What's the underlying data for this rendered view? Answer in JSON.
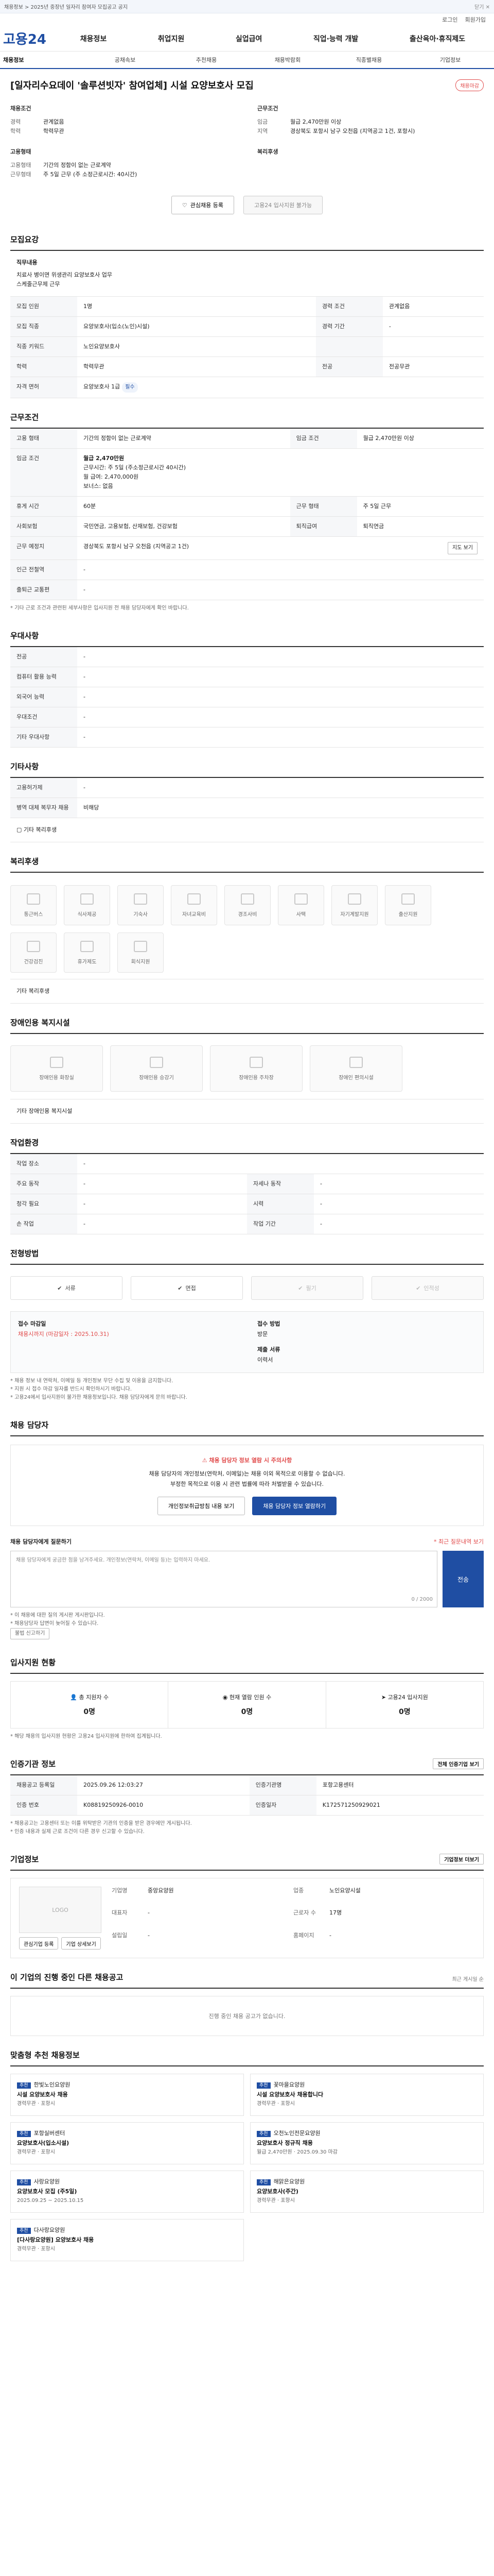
{
  "topbar": {
    "text": "채용정보 > 2025년 중장년 일자리 참여자 모집공고 공지",
    "close": "닫기 ✕"
  },
  "util": {
    "links": [
      "로그인",
      "회원가입"
    ]
  },
  "gnb": {
    "logo": "고용24",
    "menu": [
      "채용정보",
      "취업지원",
      "실업급여",
      "직업·능력 개발",
      "출산육아·휴직제도"
    ]
  },
  "subnav": [
    "채용정보",
    "공채속보",
    "추천채용",
    "채용박람회",
    "직종별채용",
    "기업정보"
  ],
  "hero": {
    "title": "[일자리수요데이 '솔루션빗자' 참여업체] 시설 요양보호사 모집",
    "badge": "채용마감",
    "left_heading": "채용조건",
    "left": [
      {
        "k": "경력",
        "v": "관계없음"
      },
      {
        "k": "학력",
        "v": "학력무관"
      }
    ],
    "left2_heading": "고용형태",
    "left2": [
      {
        "k": "고용형태",
        "v": "기간의 정함이 없는 근로계약"
      },
      {
        "k": "근무형태",
        "v": "주 5일 근무 (주 소정근로시간: 40시간)"
      }
    ],
    "right_heading": "근무조건",
    "right": [
      {
        "k": "임금",
        "v": "월급 2,470만원 이상"
      },
      {
        "k": "지역",
        "v": "경상북도 포항시 남구 오천읍 (지역공고 1건, 포항시)"
      }
    ],
    "right2_heading": "복리후생",
    "scrap_btn": "관심채용 등록",
    "apply_btn": "고용24 입사지원 불가능"
  },
  "recruit_title": "모집요강",
  "duties": {
    "label": "직무내용",
    "lines": [
      "치료사 병이면 위생관리 요양보호사 업무",
      "스케줄근무제 근무"
    ]
  },
  "recruit_rows": [
    {
      "k": "모집 인원",
      "v": "1명",
      "k2": "경력 조건",
      "v2": "관계없음"
    },
    {
      "k": "모집 직종",
      "v": "요양보호사(입소(노인)시설)",
      "k2": "경력 기간",
      "v2": "-"
    },
    {
      "k": "직종 키워드",
      "v": "노인요양보호사",
      "k2": "",
      "v2": ""
    },
    {
      "k": "학력",
      "v": "학력무관",
      "k2": "전공",
      "v2": "전공무관"
    },
    {
      "k": "자격 면허",
      "v": "요양보호사 1급",
      "k2": "",
      "v2": ""
    }
  ],
  "work_title": "근무조건",
  "work": {
    "type": "기간의 정함이 없는 근로계약",
    "probation_k": "임금 조건",
    "probation": "월급 2,470만원 이상",
    "wage_detail": [
      "월급 2,470만원",
      "근무시간: 주 5일 (주소정근로시간 40시간)",
      "월 급여: 2,470,000원",
      "보너스: 없음"
    ],
    "rest_k": "휴게 시간",
    "rest": "60분",
    "days_k": "근무 형태",
    "days": "주 5일 근무",
    "insurance_k": "사회보험",
    "insurance": "국민연금, 고용보험, 산재보험, 건강보험",
    "retire_k": "퇴직급여",
    "retire": "퇴직연금",
    "place_k": "근무 예정지",
    "place": "경상북도 포항시 남구 오천읍 (지역공고 1건)",
    "place_btn": "지도 보기",
    "commute_k": "인근 전철역",
    "commute": "-",
    "vehicle_k": "출퇴근 교통편",
    "vehicle": "-",
    "note": "* 기타 근로 조건과 관련된 세부사항은 입사지원 전 채용 담당자에게 확인 바랍니다."
  },
  "special_title": "우대사항",
  "special_rows": [
    {
      "k": "전공",
      "v": "-"
    },
    {
      "k": "컴퓨터 활용 능력",
      "v": "-"
    },
    {
      "k": "외국어 능력",
      "v": "-"
    },
    {
      "k": "우대조건",
      "v": "-"
    },
    {
      "k": "기타 우대사항",
      "v": "-"
    }
  ],
  "etc_title": "기타사항",
  "etc_rows": [
    {
      "k": "고용허가제",
      "v": "-"
    },
    {
      "k": "병역 대체 복무자 채용",
      "v": "비해당"
    }
  ],
  "etc_more": "기타 복리후생",
  "welfare_title": "복리후생",
  "welfare_icons": [
    "통근버스",
    "식사제공",
    "기숙사",
    "자녀교육비",
    "경조사비",
    "사택",
    "자기계발지원",
    "출산지원",
    "건강검진",
    "휴가제도",
    "회식지원"
  ],
  "welfare_etc": "기타 복리후생",
  "disabled_title": "장애인용 복지시설",
  "disabled_icons": [
    "장애인용 화장실",
    "장애인용 승강기",
    "장애인용 주차장",
    "장애인 편의시설"
  ],
  "disabled_etc": "기타 장애인용 복지시설",
  "conditions_title": "작업환경",
  "conditions_rows": [
    {
      "k": "작업 장소",
      "v": "-",
      "k2": "",
      "v2": ""
    },
    {
      "k": "주요 동작",
      "v": "-",
      "k2": "자세나 동작",
      "v2": "-"
    },
    {
      "k": "청각 필요",
      "v": "-",
      "k2": "시력",
      "v2": "-"
    },
    {
      "k": "손 작업",
      "v": "-",
      "k2": "작업 기간",
      "v2": "-"
    }
  ],
  "method_title": "전형방법",
  "methods": [
    "서류",
    "면접",
    "필기",
    "인적성"
  ],
  "apply": {
    "col1_label": "접수 마감일",
    "col1_value": "채용시까지 (마감일자 : 2025.10.31)",
    "col2_label": "접수 방법",
    "col2_value": "방문",
    "col3_label": "제출 서류",
    "col3_value": "이력서"
  },
  "apply_notes": [
    "* 채용 정보 내 연락처, 이메일 등 개인정보 무단 수집 및 이용을 금지합니다.",
    "* 지원 시 접수 마감 일자를 반드시 확인하시기 바랍니다.",
    "* 고용24에서 입사지원이 불가한 채용정보입니다. 채용 담당자에게 문의 바랍니다."
  ],
  "contact_title": "채용 담당자",
  "contact": {
    "alert_title": "⚠ 채용 담당자 정보 열람 시 주의사항",
    "alert_lines": [
      "채용 담당자의 개인정보(연락처, 이메일)는 채용 이외 목적으로 이용할 수 없습니다.",
      "부정한 목적으로 이용 시 관련 법률에 따라 처벌받을 수 있습니다."
    ],
    "btn1": "개인정보취급방침 내용 보기",
    "btn2": "채용 담당자 정보 열람하기"
  },
  "qa": {
    "label": "채용 담당자에게 질문하기",
    "hint": "* 최근 질문내역 보기",
    "placeholder": "채용 담당자에게 궁금한 점을 남겨주세요. 개인정보(연락처, 이메일 등)는 입력하지 마세요.",
    "count": "0 / 2000",
    "send": "전송",
    "notes": [
      "* 이 채용에 대한 질의 게시판 게시판입니다.",
      "* 채용담당자 답변이 늦어질 수 있습니다."
    ],
    "report_btn": "불법 신고하기"
  },
  "stats_title": "입사지원 현황",
  "stats": [
    {
      "label": "총 지원자 수",
      "value": "0명"
    },
    {
      "label": "현재 열람 인원 수",
      "value": "0명"
    },
    {
      "label": "고용24 입사지원",
      "value": "0명"
    }
  ],
  "stats_note": "* 해당 채용의 입사지원 현황은 고용24 입사지원에 한하여 집계됩니다.",
  "jobinfo_title": "인증기관 정보",
  "jobinfo_btn": "전체 인증기업 보기",
  "jobinfo_rows": [
    {
      "k": "채용공고 등록일",
      "v": "2025.09.26 12:03:27",
      "k2": "인증기관명",
      "v2": "포항고용센터"
    },
    {
      "k": "인증 번호",
      "v": "K08819250926-0010",
      "k2": "인증일자",
      "v2": "K172571250929021"
    }
  ],
  "jobinfo_notes": [
    "* 채용공고는 고용센터 또는 이를 위탁받은 기관의 인증을 받은 경우에만 게시됩니다.",
    "* 인증 내용과 실제 근로 조건이 다른 경우 신고할 수 있습니다."
  ],
  "company_title": "기업정보",
  "company_btn": "기업정보 더보기",
  "company": {
    "logo": "LOGO",
    "rows": [
      {
        "k": "기업명",
        "v": "중앙요양원",
        "k2": "업종",
        "v2": "노인요양시설"
      },
      {
        "k": "대표자",
        "v": "-",
        "k2": "근로자 수",
        "v2": "17명"
      },
      {
        "k": "설립일",
        "v": "-",
        "k2": "홈페이지",
        "v2": "-"
      }
    ],
    "btn1": "관심기업 등록",
    "btn2": "기업 상세보기"
  },
  "other_title": "이 기업의 진행 중인 다른 채용공고",
  "other_hint": "최근 게시일 순",
  "other_empty": "진행 중인 채용 공고가 없습니다.",
  "rec_title": "맞춤형 추천 채용정보",
  "recs": [
    {
      "tag": "추천",
      "org": "한빛노인요양원",
      "t": "시설 요양보호사 채용",
      "m": "경력무관 · 포항시"
    },
    {
      "tag": "추천",
      "org": "꽃마을요양원",
      "t": "시설 요양보호사 채용합니다",
      "m": "경력무관 · 포항시"
    },
    {
      "tag": "추천",
      "org": "포항실버센터",
      "t": "요양보호사(입소시설)",
      "m": "경력무관 · 포항시"
    },
    {
      "tag": "추천",
      "org": "오천노인전문요양원",
      "t": "요양보호사 정규직 채용",
      "m": "월급 2,470만원 · 2025.09.30 마감"
    },
    {
      "tag": "추천",
      "org": "사랑요양원",
      "t": "요양보호사 모집 (주5일)",
      "m": "2025.09.25 ~ 2025.10.15"
    },
    {
      "tag": "추천",
      "org": "해맑은요양원",
      "t": "요양보호사(주간)",
      "m": "경력무관 · 포항시"
    },
    {
      "tag": "추천",
      "org": "다사랑요양원",
      "t": "[다사랑요양원] 요양보호사 채용",
      "m": "경력무관 · 포항시"
    }
  ]
}
